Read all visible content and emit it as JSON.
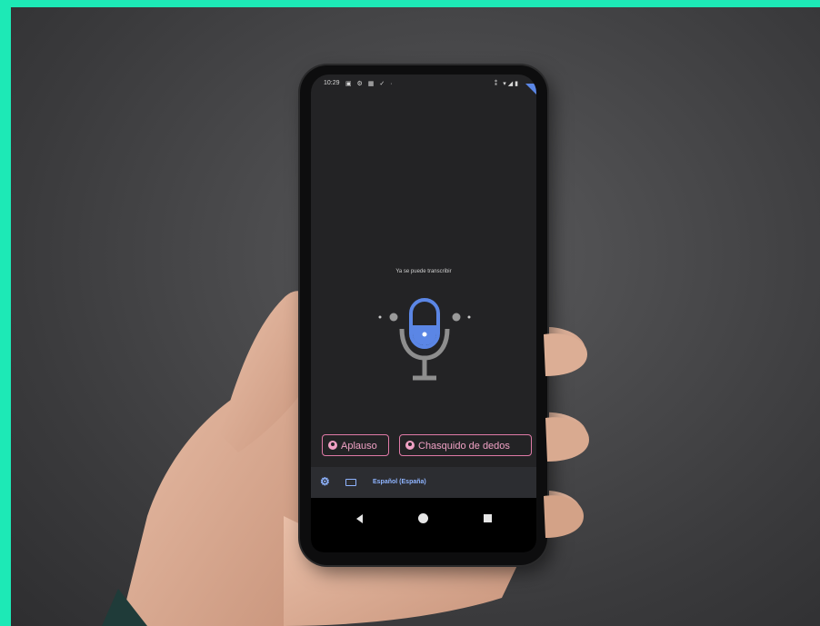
{
  "status": {
    "time": "10:29",
    "left_icons": "▣ ⚙ ▦ ✓ ·",
    "right_icons": "⁑ ▾◢▮"
  },
  "app": {
    "prompt": "Ya se puede transcribir",
    "mic_icon": "microphone-lock-icon",
    "chips": [
      {
        "label": "Aplauso",
        "icon": "person-icon"
      },
      {
        "label": "Chasquido de dedos",
        "icon": "person-icon"
      }
    ],
    "language_bar": {
      "settings_icon": "gear-icon",
      "keyboard_icon": "keyboard-icon",
      "language": "Español (España)"
    }
  },
  "nav": {
    "back_icon": "back-triangle-icon",
    "home_icon": "home-circle-icon",
    "recents_icon": "recents-square-icon"
  },
  "colors": {
    "frame": "#1de9b6",
    "accent_blue": "#5b86e5",
    "chip_pink": "#e07aa7",
    "screen_bg": "#232325"
  }
}
